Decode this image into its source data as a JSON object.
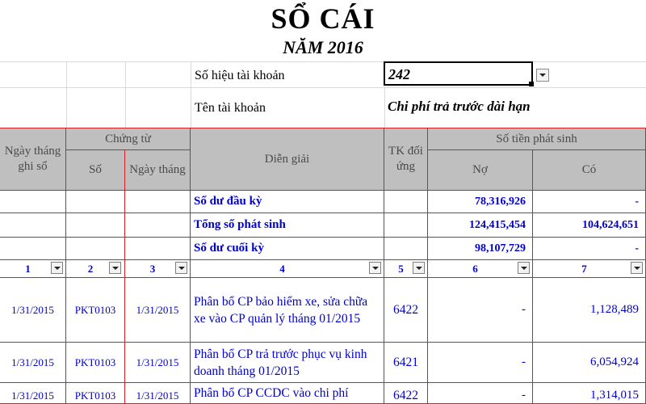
{
  "sheet": {
    "title": "SỔ CÁI",
    "year_label": "NĂM 2016",
    "account_code_label": "Số hiệu tài khoản",
    "account_code_value": "242",
    "account_name_label": "Tên tài khoản",
    "account_name_value": "Chi phí trả trước dài hạn"
  },
  "table": {
    "headers": {
      "record_date": "Ngày tháng ghi sổ",
      "voucher": "Chứng từ",
      "voucher_no": "Số",
      "voucher_date": "Ngày tháng",
      "description": "Diễn giải",
      "contra_account": "TK đối ứng",
      "amount": "Số tiền phát sinh",
      "debit": "Nợ",
      "credit": "Có"
    },
    "summary": [
      {
        "label": "Số dư đầu kỳ",
        "debit": "78,316,926",
        "credit": "-"
      },
      {
        "label": "Tổng số phát sinh",
        "debit": "124,415,454",
        "credit": "104,624,651"
      },
      {
        "label": "Số dư cuối kỳ",
        "debit": "98,107,729",
        "credit": "-"
      }
    ],
    "column_numbers": [
      "1",
      "2",
      "3",
      "4",
      "5",
      "6",
      "7"
    ],
    "rows": [
      {
        "record_date": "1/31/2015",
        "voucher_no": "PKT0103",
        "voucher_date": "1/31/2015",
        "description": "Phân bổ CP bảo hiểm xe, sửa chữa xe vào CP quản lý tháng 01/2015",
        "contra": "6422",
        "debit": "-",
        "credit": "1,128,489"
      },
      {
        "record_date": "1/31/2015",
        "voucher_no": "PKT0103",
        "voucher_date": "1/31/2015",
        "description": "Phân bổ CP trả trước phục vụ kinh doanh tháng 01/2015",
        "contra": "6421",
        "debit": "-",
        "credit": "6,054,924"
      },
      {
        "record_date": "1/31/2015",
        "voucher_no": "PKT0103",
        "voucher_date": "1/31/2015",
        "description": "Phân bổ CP CCDC vào chi phí",
        "contra": "6422",
        "debit": "-",
        "credit": "1,314,015"
      }
    ]
  }
}
